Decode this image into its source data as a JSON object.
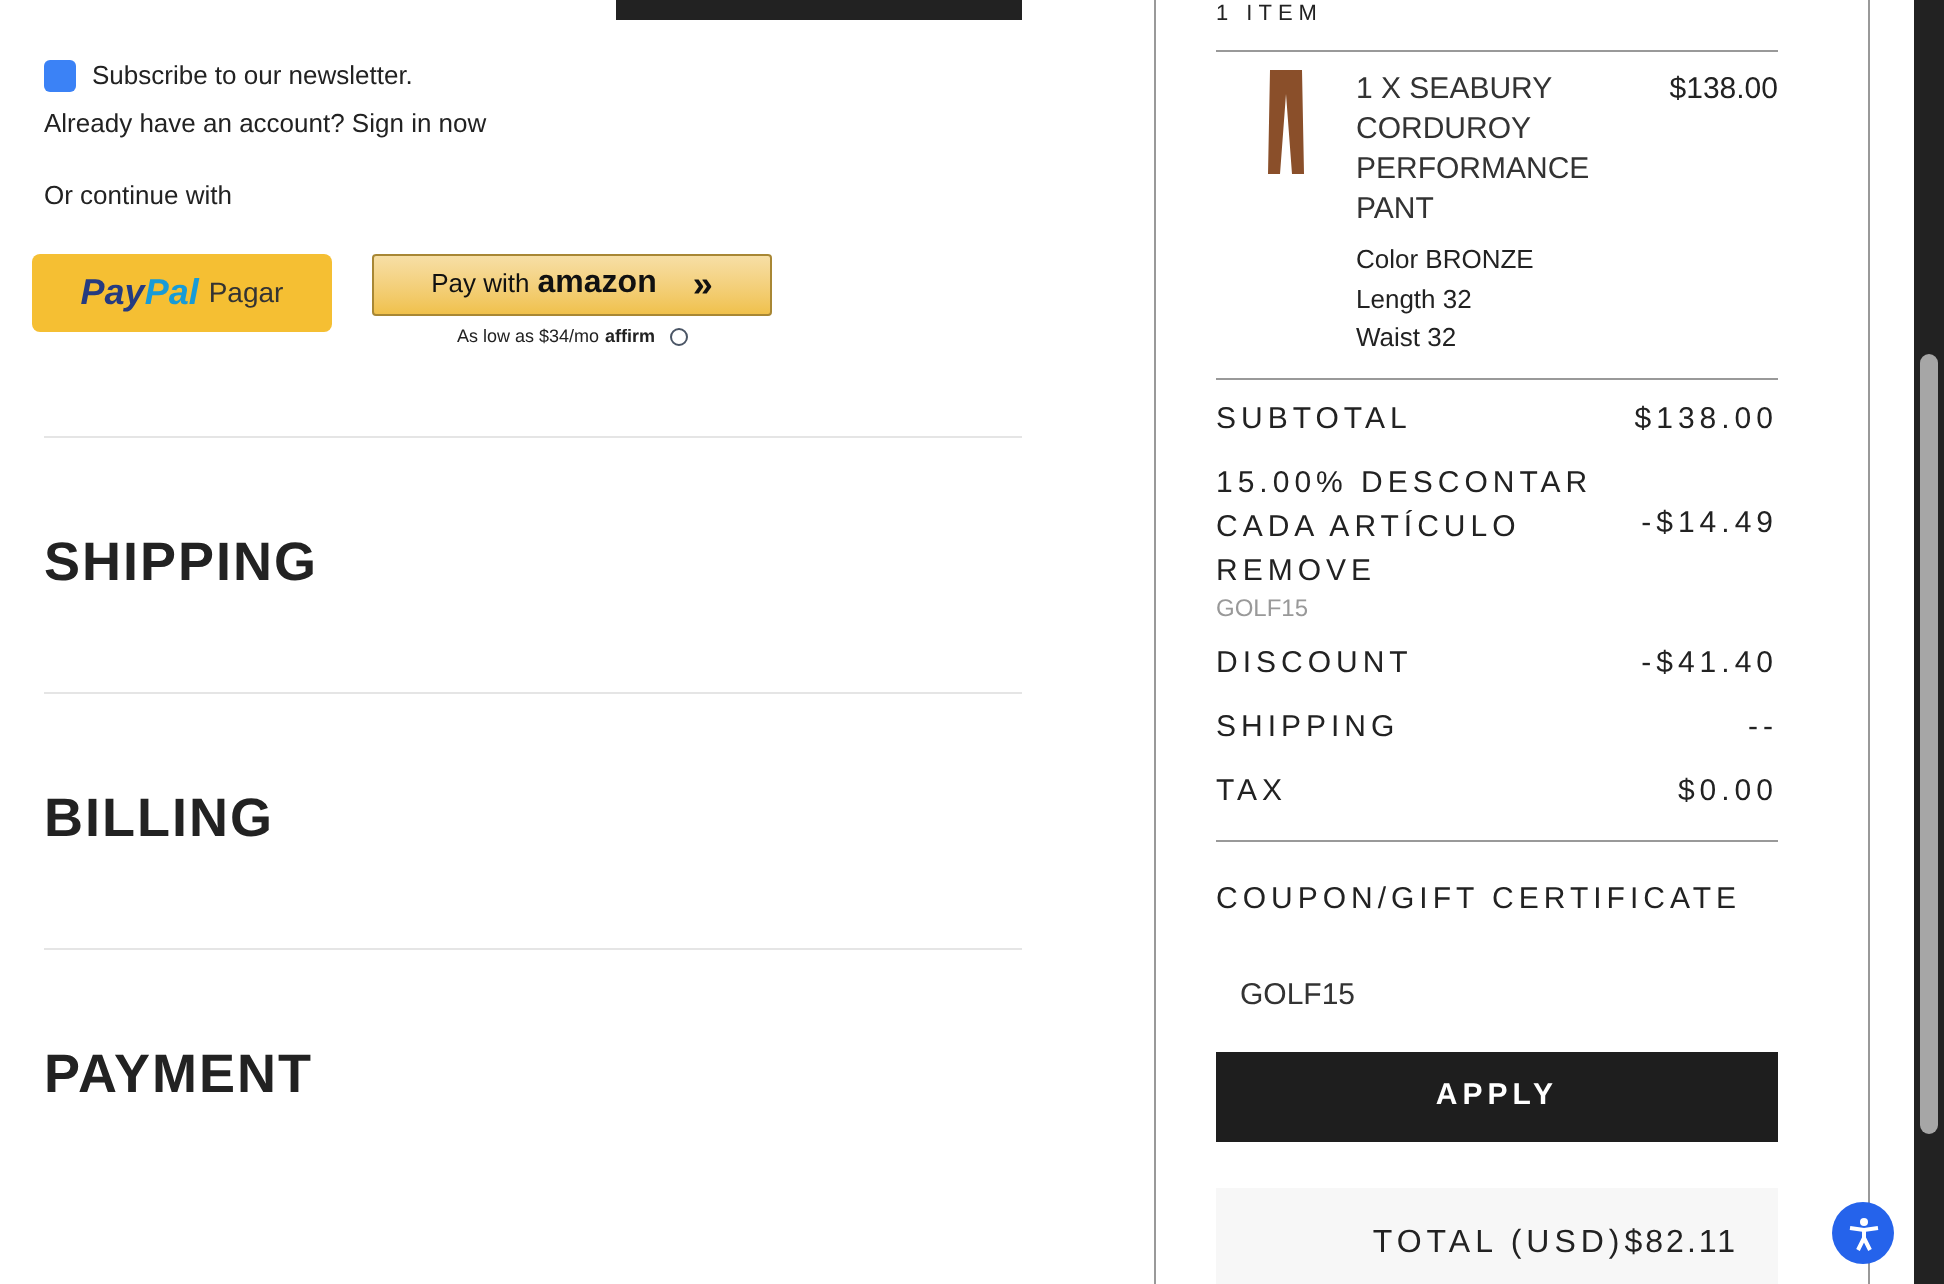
{
  "newsletter": {
    "label": "Subscribe to our newsletter.",
    "checked": true
  },
  "account_prompt": "Already have an account? Sign in now",
  "continue_label": "Or continue with",
  "paypal": {
    "brand_pay": "Pay",
    "brand_pal": "Pal",
    "label": "Pagar"
  },
  "amazon": {
    "label": "Pay with",
    "brand": "amazon",
    "arrows": "»",
    "financing": "As low as $34/mo",
    "affirm": "affirm"
  },
  "sections": [
    {
      "title": "SHIPPING"
    },
    {
      "title": "BILLING"
    },
    {
      "title": "PAYMENT"
    }
  ],
  "summary": {
    "heading": "1 ITEM",
    "items": [
      {
        "name": "1 X SEABURY CORDUROY PERFORMANCE PANT",
        "price": "$138.00",
        "details": [
          "Color BRONZE",
          "Length 32",
          "Waist 32"
        ]
      }
    ],
    "lines": [
      {
        "kind": "plain",
        "label": "SUBTOTAL",
        "value": "$138.00"
      },
      {
        "kind": "coupon",
        "label": "15.00% DESCONTAR CADA ARTÍCULO",
        "action": "REMOVE",
        "code": "GOLF15",
        "value": "-$14.49"
      },
      {
        "kind": "plain",
        "label": "DISCOUNT",
        "value": "-$41.40"
      },
      {
        "kind": "plain",
        "label": "SHIPPING",
        "value": "--"
      },
      {
        "kind": "plain",
        "label": "TAX",
        "value": "$0.00"
      }
    ],
    "coupon_label": "COUPON/GIFT CERTIFICATE",
    "coupon_value": "GOLF15",
    "apply": "APPLY",
    "total_label": "TOTAL (USD)",
    "total": "$82.11"
  }
}
